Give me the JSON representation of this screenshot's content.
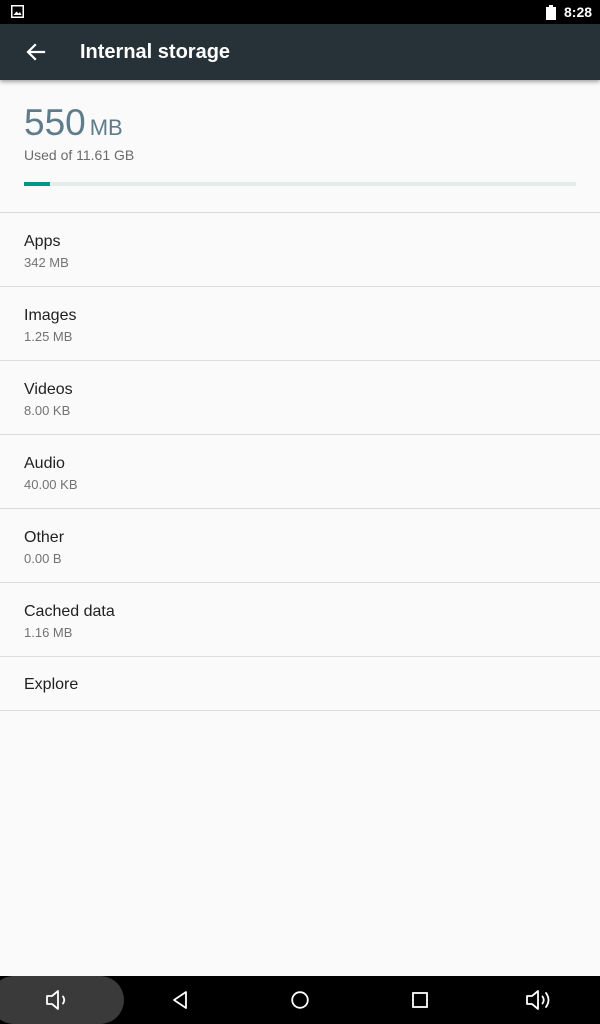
{
  "status_bar": {
    "time": "8:28",
    "notification_icon": "image-notification-icon",
    "battery_icon": "battery-full-icon"
  },
  "app_bar": {
    "back_icon": "arrow-back-icon",
    "title": "Internal storage",
    "background_color": "#263238"
  },
  "summary": {
    "used_value": "550",
    "used_unit": "MB",
    "used_caption": "Used of 11.61 GB",
    "progress_fraction": 0.047,
    "accent_color": "#009688"
  },
  "categories": [
    {
      "label": "Apps",
      "size": "342 MB"
    },
    {
      "label": "Images",
      "size": "1.25 MB"
    },
    {
      "label": "Videos",
      "size": "8.00 KB"
    },
    {
      "label": "Audio",
      "size": "40.00 KB"
    },
    {
      "label": "Other",
      "size": "0.00 B"
    },
    {
      "label": "Cached data",
      "size": "1.16 MB"
    }
  ],
  "explore": {
    "label": "Explore"
  },
  "nav_bar": {
    "buttons": [
      {
        "icon": "volume-down-icon"
      },
      {
        "icon": "back-triangle-icon"
      },
      {
        "icon": "home-circle-icon"
      },
      {
        "icon": "recents-square-icon"
      },
      {
        "icon": "volume-up-icon"
      }
    ]
  }
}
